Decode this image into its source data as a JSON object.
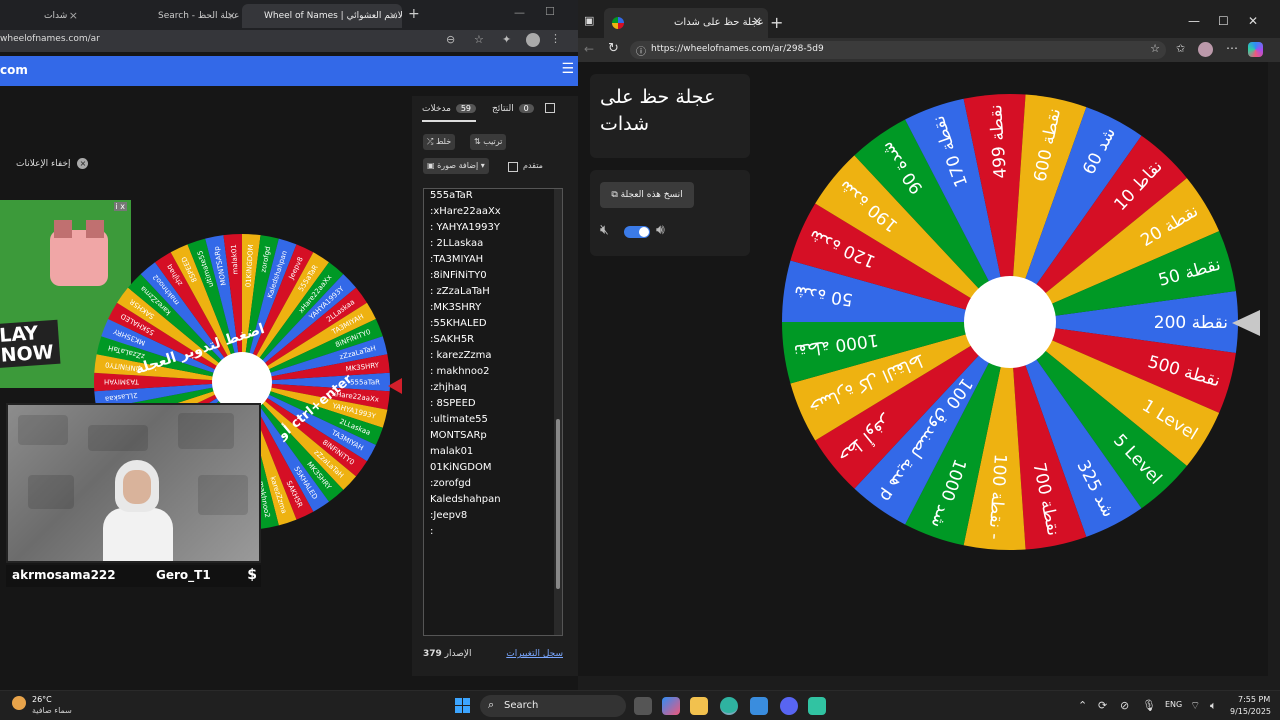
{
  "left_browser": {
    "tabs": [
      {
        "label": "شدات"
      },
      {
        "label": "Search - عجلة الحظ"
      },
      {
        "label": "Wheel of Names | الاسم العشوائي"
      }
    ],
    "url": "wheelofnames.com/ar",
    "site_label": "com",
    "close_ads": "إخفاء الإعلانات",
    "ad_text": "LAY\nNOW",
    "webcam": {
      "name1": "akrmosama222",
      "name2": "Gero_T1",
      "symbol": "$"
    },
    "small_wheel": {
      "center_text_top": "اضغط لتدوير العجلة",
      "center_text_bottom": "أو ctrl+enter",
      "names": [
        "555aTaR",
        "xHare22aaXx",
        "YAHYA1993Y",
        "2LLaskaa",
        "TA3MIYAH",
        "8iNFiNiTY0",
        "zZzaLaTaH",
        "MK3SHRY",
        "55KHALED",
        "SAKH5R",
        "karezZzma",
        "makhnoo2",
        "zhjhaq",
        "8SPEED",
        "ultimate55",
        "MONTSARp",
        "malak01",
        "01KiNGDOM",
        "zorofgd",
        "Kaledshahpan",
        "Jeepv8"
      ]
    },
    "entries_panel": {
      "tab_entries": "مدخلات",
      "entries_count": "59",
      "tab_results": "النتائج",
      "results_count": "0",
      "shuffle": "خلط",
      "sort": "ترتيب",
      "add_image": "إضافة صورة",
      "advanced": "متقدم",
      "entries": [
        "555aTaR",
        ":xHare22aaXx",
        ": YAHYA1993Y",
        ": 2LLaskaa",
        ":TA3MIYAH",
        ":8iNFiNiTY0",
        ": zZzaLaTaH",
        ":MK3SHRY",
        ":55KHALED",
        ":SAKH5R",
        ": karezZzma",
        ": makhnoo2",
        ":zhjhaq",
        ": 8SPEED",
        ":ultimate55",
        "MONTSARp",
        "malak01",
        "01KiNGDOM",
        ":zorofgd",
        "Kaledshahpan",
        ":Jeepv8",
        ":"
      ],
      "version_label": "الإصدار",
      "version_number": "379",
      "changelog": "سجل التغييرات"
    }
  },
  "right_browser": {
    "tab_title": "عجلة حظ على شدات",
    "url": "https://wheelofnames.com/ar/298-5d9",
    "wheel_title": "عجلة حظ على\nشدات",
    "copy_button": "انسخ هذه العجلة",
    "segments": [
      {
        "label": "نقطة 200",
        "color": "#3369e8"
      },
      {
        "label": "نقطة 500",
        "color": "#d50f25"
      },
      {
        "label": "1 Level",
        "color": "#eeb211"
      },
      {
        "label": "5 Level",
        "color": "#009925"
      },
      {
        "label": "شد 325",
        "color": "#3369e8"
      },
      {
        "label": "نقطة 700",
        "color": "#d50f25"
      },
      {
        "label": "نقطة 100 -",
        "color": "#eeb211"
      },
      {
        "label": "شد 1000",
        "color": "#009925"
      },
      {
        "label": "هدية لصندوق 100 p",
        "color": "#3369e8"
      },
      {
        "label": "حظ أوفر",
        "color": "#d50f25"
      },
      {
        "label": "خسارة كل النقاط",
        "color": "#eeb211"
      },
      {
        "label": "1000 نقطة",
        "color": "#009925"
      },
      {
        "label": "50 شدة",
        "color": "#3369e8"
      },
      {
        "label": "120 شدة",
        "color": "#d50f25"
      },
      {
        "label": "190 شدة",
        "color": "#eeb211"
      },
      {
        "label": "90 شدة",
        "color": "#009925"
      },
      {
        "label": "170 نقطة",
        "color": "#3369e8"
      },
      {
        "label": "نقطة 499",
        "color": "#d50f25"
      },
      {
        "label": "نقطة 600",
        "color": "#eeb211"
      },
      {
        "label": "شد 60",
        "color": "#3369e8"
      },
      {
        "label": "نقاط 10",
        "color": "#d50f25"
      },
      {
        "label": "نقطة 20",
        "color": "#eeb211"
      },
      {
        "label": "نقطة 50",
        "color": "#009925"
      }
    ]
  },
  "taskbar": {
    "weather_temp": "26°C",
    "weather_desc": "سماء صافية",
    "search_label": "Search",
    "lang": "ENG",
    "time": "7:55 PM",
    "date": "9/15/2025"
  }
}
